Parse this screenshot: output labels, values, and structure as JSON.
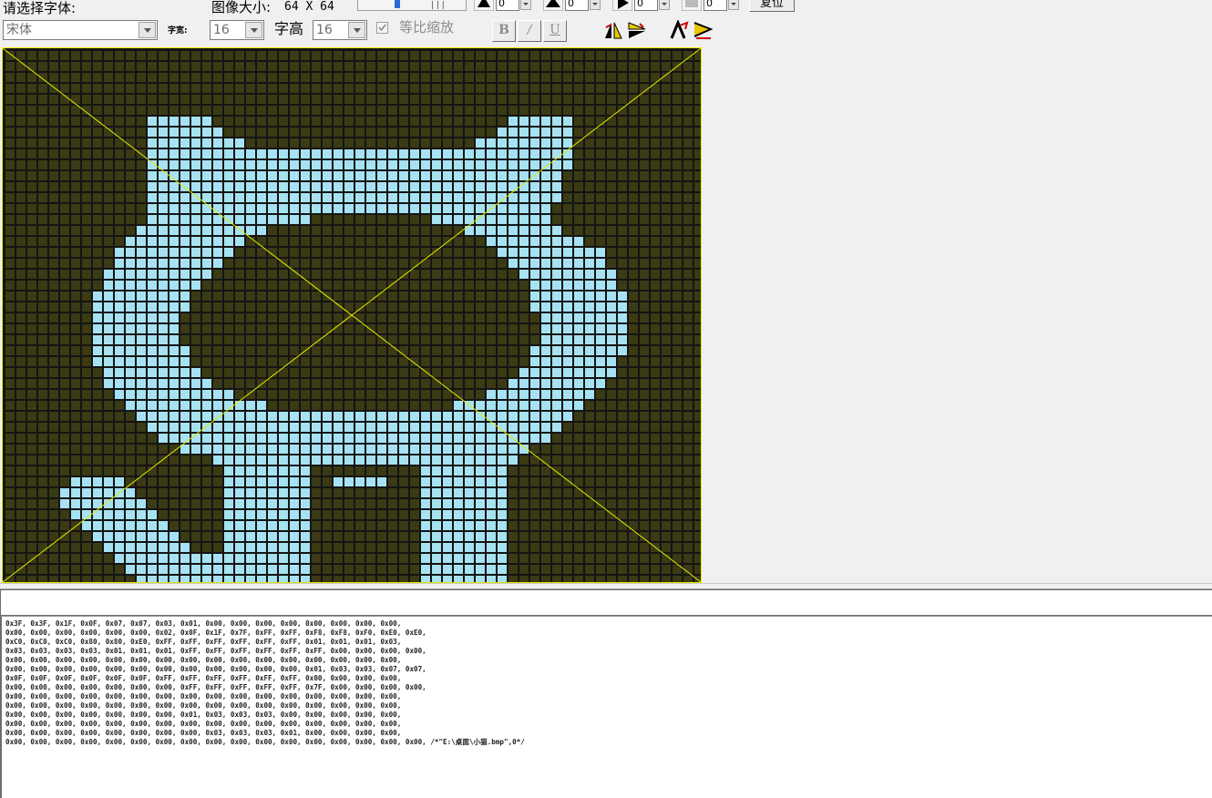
{
  "toolbar": {
    "font_prompt": "请选择字体:",
    "font_value": "宋体",
    "width_label": "字宽:",
    "width_value": "16",
    "height_label": "字高",
    "height_value": "16",
    "keep_ratio_label": "等比缩放",
    "keep_ratio_checked": true,
    "bold_label": "B",
    "italic_label": "/",
    "underline_label": "U",
    "image_size_label": "图像大小:",
    "image_size_value": "64 X 64",
    "spin_values": [
      "0",
      "0",
      "0",
      "0"
    ],
    "reset_label": "复位"
  },
  "editor": {
    "grid_cols": 64,
    "grid_rows": 49,
    "colors": {
      "background": "#141414",
      "off_cell": "#3a3a14",
      "on_cell": "#a6e2f2",
      "guide_line": "#e8e800"
    },
    "pixel_rows": [
      "0000000000000000000000000000000000000000000000000000000000000000",
      "0000000000000000000000000000000000000000000000000000000000000000",
      "0000000000000000000000000000000000000000000000000000000000000000",
      "0000000000000000000000000000000000000000000000000000000000000000",
      "0000000000000000000000000000000000000000000000000000000000000000",
      "0000000000000000000000000000000000000000000000000000000000000000",
      "0000000000000111111000000000000000000000000000111111000000000000",
      "0000000000000111111100000000000000000000000001111111000000000000",
      "0000000000000111111111000000000000000000000111111111000000000000",
      "0000000000000111111111111111111111111111111111111111000000000000",
      "0000000000000111111111111111111111111111111111111111000000000000",
      "0000000000000111111111111111111111111111111111111110000000000000",
      "0000000000000111111111111111111111111111111111111110000000000000",
      "0000000000000111111111111111111111111111111111111110000000000000",
      "0000000000000111111111111111111111111111111111111100000000000000",
      "0000000000000111111111111111000000000001111111111100000000000000",
      "0000000000001111111111110000000000000000001111111110000000000000",
      "0000000000011111111111000000000000000000000011111111100000000000",
      "0000000000111111111110000000000000000000000001111111111000000000",
      "0000000000111111111100000000000000000000000000111111111000000000",
      "0000000001111111111000000000000000000000000000011111111100000000",
      "0000000001111111110000000000000000000000000000001111111100000000",
      "0000000011111111100000000000000000000000000000001111111110000000",
      "0000000011111111100000000000000000000000000000001111111110000000",
      "0000000011111111000000000000000000000000000000000111111110000000",
      "0000000011111111000000000000000000000000000000000111111110000000",
      "0000000011111111000000000000000000000000000000000111111110000000",
      "0000000011111111100000000000000000000000000000001111111110000000",
      "0000000011111111100000000000000000000000000000001111111100000000",
      "0000000001111111110000000000000000000000000000011111111100000000",
      "0000000001111111111000000000000000000000000000111111111000000000",
      "0000000000111111111110000000000000000000000011111111110000000000",
      "0000000000011111111111110000000000000000011111111111100000000000",
      "0000000000001111111111111111111111111111111111111111000000000000",
      "0000000000000111111111111111111111111111111111111110000000000000",
      "0000000000000011111111111111111111111111111111111100000000000000",
      "0000000000000000111111111111111111111111111111110000000000000000",
      "0000000000000000000111111111111111111111111111100000000000000000",
      "0000000000000000000011111111000000000011111111000000000000000000",
      "0000001111100000000011111111001111100011111111000000000000000000",
      "0000011111110000000011111111000000000011111111000000000000000000",
      "0000011111111000000011111111000000000011111111000000000000000000",
      "0000001111111100000011111111000000000011111111000000000000000000",
      "0000000111111110000011111111000000000011111111000000000000000000",
      "0000000011111111000011111111000000000011111111000000000000000000",
      "0000000001111111100011111111000000000011111111000000000000000000",
      "0000000000111111111111111111000000000011111111000000000000000000",
      "0000000000011111111111111111000000000011111111000000000000000000",
      "0000000000001111111111111111000000000011111111000000000000000000"
    ]
  },
  "output": {
    "lines": [
      "0x3F, 0x3F, 0x1F, 0x0F, 0x07, 0x07, 0x03, 0x01, 0x00, 0x00, 0x00, 0x00, 0x00, 0x00, 0x00, 0x00,",
      "0x00, 0x00, 0x00, 0x00, 0x00, 0x00, 0x02, 0x0F, 0x1F, 0x7F, 0xFF, 0xFF, 0xF8, 0xF8, 0xF0, 0xE0, 0xE0,",
      "0xC0, 0xC0, 0xC0, 0x80, 0x80, 0xE0, 0xFF, 0xFF, 0xFF, 0xFF, 0xFF, 0xFF, 0x01, 0x01, 0x01, 0x03,",
      "0x03, 0x03, 0x03, 0x03, 0x01, 0x01, 0x01, 0xFF, 0xFF, 0xFF, 0xFF, 0xFF, 0xFF, 0x00, 0x00, 0x00, 0x00,",
      "0x00, 0x00, 0x00, 0x00, 0x00, 0x00, 0x00, 0x00, 0x00, 0x00, 0x00, 0x00, 0x00, 0x00, 0x00, 0x00,",
      "0x00, 0x00, 0x00, 0x00, 0x00, 0x00, 0x00, 0x00, 0x00, 0x00, 0x00, 0x00, 0x01, 0x03, 0x03, 0x07, 0x07,",
      "0x0F, 0x0F, 0x0F, 0x0F, 0x0F, 0x0F, 0xFF, 0xFF, 0xFF, 0xFF, 0xFF, 0xFF, 0x00, 0x00, 0x00, 0x00,",
      "0x00, 0x00, 0x00, 0x00, 0x00, 0x00, 0x00, 0xFF, 0xFF, 0xFF, 0xFF, 0xFF, 0x7F, 0x00, 0x00, 0x00, 0x00,",
      "0x00, 0x00, 0x00, 0x00, 0x00, 0x00, 0x00, 0x00, 0x00, 0x00, 0x00, 0x00, 0x00, 0x00, 0x00, 0x00,",
      "0x00, 0x00, 0x00, 0x00, 0x00, 0x00, 0x00, 0x00, 0x00, 0x00, 0x00, 0x00, 0x00, 0x00, 0x00, 0x00,",
      "0x00, 0x00, 0x00, 0x00, 0x00, 0x00, 0x00, 0x01, 0x03, 0x03, 0x03, 0x00, 0x00, 0x00, 0x00, 0x00,",
      "0x00, 0x00, 0x00, 0x00, 0x00, 0x00, 0x00, 0x00, 0x00, 0x00, 0x00, 0x00, 0x00, 0x00, 0x00, 0x00,",
      "0x00, 0x00, 0x00, 0x00, 0x00, 0x00, 0x00, 0x00, 0x03, 0x03, 0x03, 0x01, 0x00, 0x00, 0x00, 0x00,",
      "0x00, 0x00, 0x00, 0x00, 0x00, 0x00, 0x00, 0x00, 0x00, 0x00, 0x00, 0x00, 0x00, 0x00, 0x00, 0x00, 0x00, /*\"E:\\桌面\\小猫.bmp\",0*/"
    ]
  }
}
